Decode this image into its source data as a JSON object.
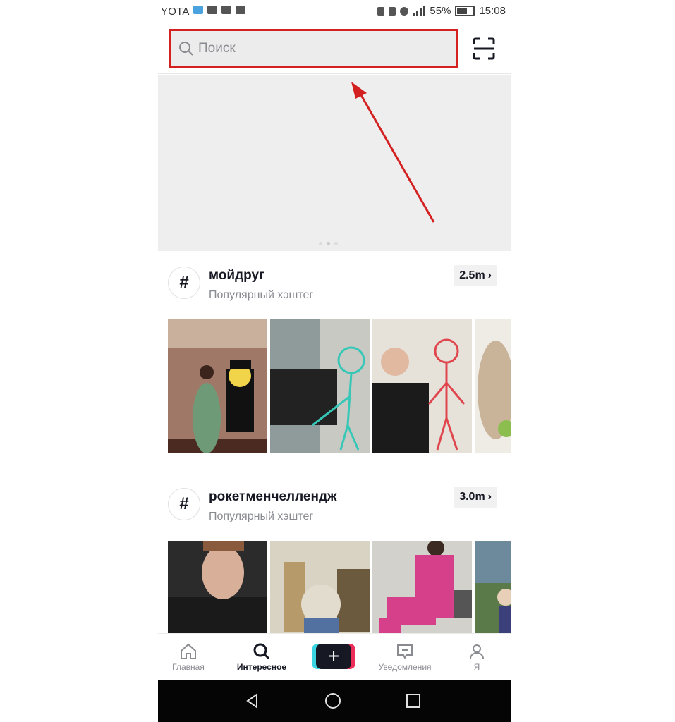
{
  "status_bar": {
    "carrier": "YOTA",
    "battery": "55%",
    "time": "15:08"
  },
  "search": {
    "placeholder": "Поиск"
  },
  "sections": [
    {
      "hashtag": "мойдруг",
      "subtitle": "Популярный хэштег",
      "count": "2.5m"
    },
    {
      "hashtag": "рокетменчеллендж",
      "subtitle": "Популярный хэштег",
      "count": "3.0m"
    }
  ],
  "tabbar": {
    "home": "Главная",
    "discover": "Интересное",
    "inbox": "Уведомления",
    "me": "Я"
  },
  "icons": {
    "search": "search-icon",
    "scan": "scan-icon",
    "hashtag": "hashtag-icon",
    "home": "home-icon",
    "inbox": "inbox-icon",
    "profile": "profile-icon",
    "plus": "plus-icon"
  },
  "colors": {
    "highlight_border": "#d32020",
    "annotation_arrow": "#d32020",
    "plus_cyan": "#3ad5e0",
    "plus_pink": "#ee2e5a"
  }
}
